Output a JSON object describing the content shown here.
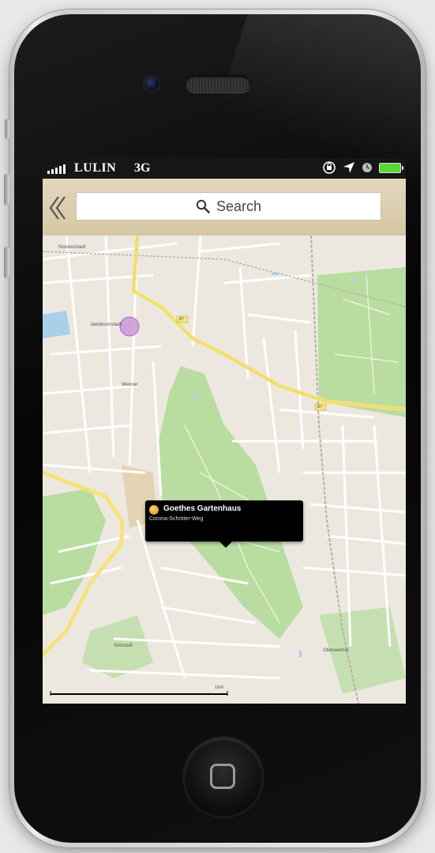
{
  "status": {
    "carrier": "LULIN",
    "network": "3G",
    "icons": [
      "rotation-lock-icon",
      "location-arrow-icon",
      "alarm-icon",
      "battery-icon"
    ],
    "battery_color": "#5bd63a"
  },
  "nav": {
    "back_icon": "double-chevron-left-icon",
    "search_placeholder": "Search"
  },
  "map": {
    "labels": {
      "nordvorstadt": "Nordvorstadt",
      "jakobsvorstadt": "Jakobsvorstadt",
      "weimar": "Weimar",
      "suedstadt": "Südstadt",
      "oberweimar": "Oberweimar",
      "b7a": "B7",
      "b7b": "B7"
    },
    "scale_label": "1km",
    "colors": {
      "park": "#b9dca0",
      "road_major": "#f5e27a",
      "land": "#ece8e0"
    }
  },
  "callout": {
    "title": "Goethes Gartenhaus",
    "subtitle": "Corona-Schröter-Weg"
  }
}
